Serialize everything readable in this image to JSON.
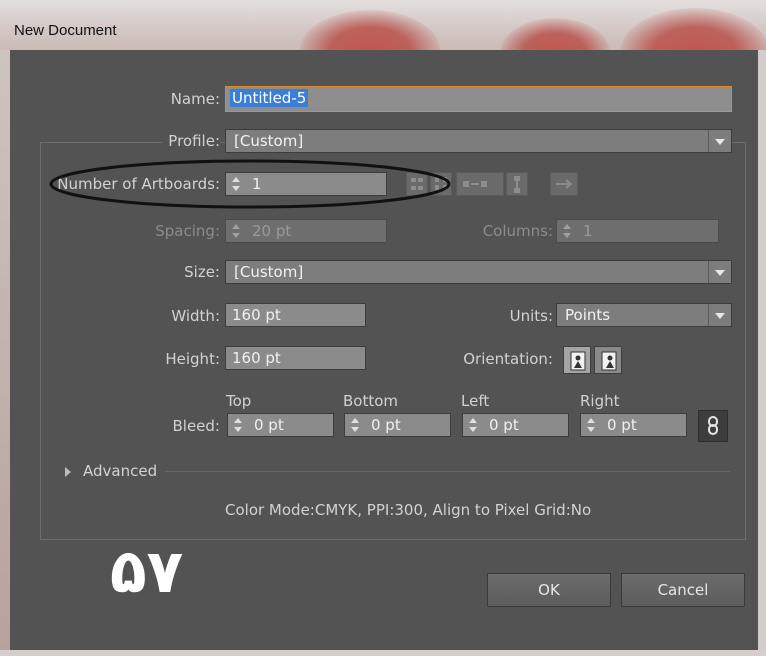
{
  "window": {
    "title": "New Document"
  },
  "name": {
    "label": "Name:",
    "value": "Untitled-5"
  },
  "profile": {
    "label": "Profile:",
    "value": "[Custom]"
  },
  "artboards": {
    "label": "Number of Artboards:",
    "value": "1"
  },
  "spacing": {
    "label": "Spacing:",
    "value": "20 pt"
  },
  "columns": {
    "label": "Columns:",
    "value": "1"
  },
  "size": {
    "label": "Size:",
    "value": "[Custom]"
  },
  "width": {
    "label": "Width:",
    "value": "160 pt"
  },
  "units": {
    "label": "Units:",
    "value": "Points"
  },
  "height": {
    "label": "Height:",
    "value": "160 pt"
  },
  "orientation": {
    "label": "Orientation:"
  },
  "bleed": {
    "label": "Bleed:",
    "top": {
      "label": "Top",
      "value": "0 pt"
    },
    "bottom": {
      "label": "Bottom",
      "value": "0 pt"
    },
    "left": {
      "label": "Left",
      "value": "0 pt"
    },
    "right": {
      "label": "Right",
      "value": "0 pt"
    }
  },
  "advanced": {
    "label": "Advanced"
  },
  "info": "Color Mode:CMYK, PPI:300, Align to Pixel Grid:No",
  "buttons": {
    "ok": "OK",
    "cancel": "Cancel"
  },
  "overlay_number": "۵۷",
  "colors": {
    "highlight": "#3a7fd5",
    "focus_border": "#e08a2e",
    "annotation": "#111111"
  }
}
